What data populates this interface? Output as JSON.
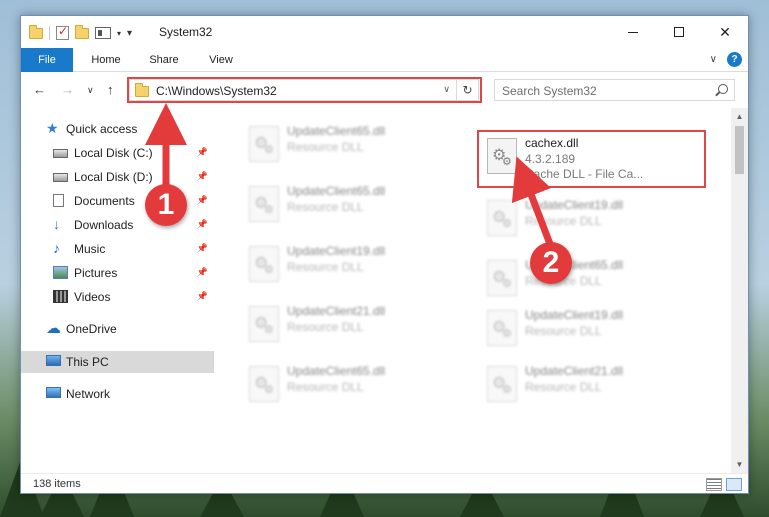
{
  "window": {
    "title": "System32",
    "controls": {
      "minimize": "",
      "maximize": "",
      "close": "✕"
    }
  },
  "ribbon": {
    "tabs": [
      {
        "label": "File"
      },
      {
        "label": "Home"
      },
      {
        "label": "Share"
      },
      {
        "label": "View"
      }
    ],
    "help": "?"
  },
  "navigation": {
    "address": "C:\\Windows\\System32",
    "search_placeholder": "Search System32"
  },
  "sidebar": {
    "quick_access": "Quick access",
    "items": [
      {
        "label": "Local Disk (C:)",
        "icon": "disk-icon",
        "pinned": true
      },
      {
        "label": "Local Disk (D:)",
        "icon": "disk-icon",
        "pinned": true
      },
      {
        "label": "Documents",
        "icon": "documents-icon",
        "pinned": true
      },
      {
        "label": "Downloads",
        "icon": "downloads-icon",
        "pinned": true
      },
      {
        "label": "Music",
        "icon": "music-icon",
        "pinned": true
      },
      {
        "label": "Pictures",
        "icon": "pictures-icon",
        "pinned": true
      },
      {
        "label": "Videos",
        "icon": "videos-icon",
        "pinned": true
      }
    ],
    "onedrive": "OneDrive",
    "this_pc": "This PC",
    "network": "Network"
  },
  "files": {
    "left_column": [
      {
        "name": "UpdateClient65.dll",
        "type": "Resource DLL"
      },
      {
        "name": "UpdateClient65.dll",
        "type": "Resource DLL"
      },
      {
        "name": "UpdateClient19.dll",
        "type": "Resource DLL"
      },
      {
        "name": "UpdateClient21.dll",
        "type": "Resource DLL"
      },
      {
        "name": "UpdateClient65.dll",
        "type": "Resource DLL"
      }
    ],
    "highlighted": {
      "name": "cachex.dll",
      "version": "4.3.2.189",
      "description": "Cache DLL - File Ca..."
    },
    "right_column": [
      {
        "name": "UpdateClient19.dll",
        "type": "Resource DLL"
      },
      {
        "name": "UpdateClient65.dll",
        "type": "Resource DLL"
      },
      {
        "name": "UpdateClient19.dll",
        "type": "Resource DLL"
      },
      {
        "name": "UpdateClient21.dll",
        "type": "Resource DLL"
      }
    ]
  },
  "status": {
    "item_count": "138 items"
  },
  "annotations": {
    "step1": "1",
    "step2": "2",
    "color": "#e33b3b"
  }
}
